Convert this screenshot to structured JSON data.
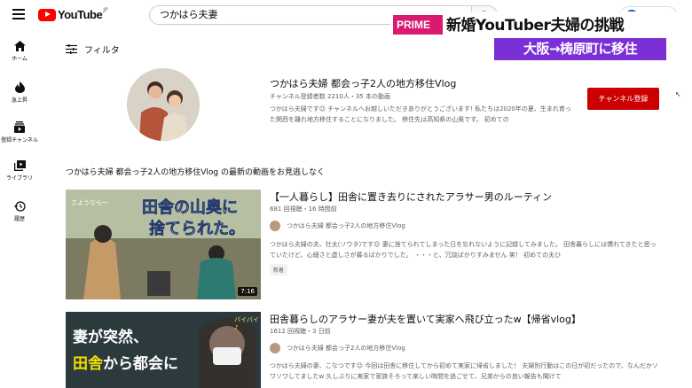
{
  "header": {
    "logo_text": "YouTube",
    "logo_country": "JP",
    "search_value": "つかはら夫妻"
  },
  "sidebar": {
    "items": [
      {
        "label": "ホーム",
        "icon": "home-icon"
      },
      {
        "label": "急上昇",
        "icon": "trending-icon"
      },
      {
        "label": "登録チャンネル",
        "icon": "subscriptions-icon"
      },
      {
        "label": "ライブラリ",
        "icon": "library-icon"
      },
      {
        "label": "履歴",
        "icon": "history-icon"
      }
    ]
  },
  "filter": {
    "label": "フィルタ"
  },
  "channel": {
    "name": "つかはら夫婦 都会っ子2人の地方移住Vlog",
    "stats": "チャンネル登録者数 2210人・35 本の動画",
    "description": "つかはら夫婦です☺ チャンネルへお越しいただきありがとうございます! 私たちは2020年の夏、生まれ育った関西を離れ地方移住することになりました。 移住先は高知県の山奥です。 初めての",
    "subscribe_label": "チャンネル登録"
  },
  "section_title": "つかはら夫婦 都会っ子2人の地方移住Vlog の最新の動画をお見逃しなく",
  "videos": [
    {
      "title": "【一人暮らし】田舎に置き去りにされたアラサー男のルーティン",
      "meta": "681 回視聴・16 時間前",
      "channel": "つかはら夫婦 都会っ子2人の地方移住Vlog",
      "description": "つかはら夫婦の夫、壮太(ソウタ)です☺ 妻に捨てられてしまった日を忘れないように記録してみました。 田舎暮らしには慣れてきたと思っていたけど、心細さと虚しさが募るばかりでした。 ・・・と、冗談ばかりすみません 笑！ 初めての夫ひ",
      "badge": "新着",
      "duration": "7:16",
      "thumb_text_1": "田舎の山奥に",
      "thumb_text_2": "捨てられた。",
      "thumb_small": "さようなら〜"
    },
    {
      "title": "田舎暮らしのアラサー妻が夫を置いて実家へ飛び立ったw【帰省vlog】",
      "meta": "1612 回視聴・3 日前",
      "channel": "つかはら夫婦 都会っ子2人の地方移住Vlog",
      "description": "つかはら夫婦の妻、こなつです☺ 今回は田舎に移住してから初めて実家に帰省しました！ 夫婦別行動はこの日が初だったので、なんだかソワソワしてましたw 久しぶりに実家で家族そろって楽しい時間を過ごせて、兄弟からの良い報告も聞けて",
      "thumb_text_1": "妻が突然、",
      "thumb_text_2": "田舎",
      "thumb_text_3": "から都会に",
      "thumb_small": "バイバイ♪"
    }
  ],
  "overlay": {
    "prime": "PRIME",
    "title": "新婚YouTuber夫婦の挑戦",
    "subtitle": "大阪→梼原町に移住"
  },
  "colors": {
    "youtube_red": "#ff0000",
    "subscribe_red": "#cc0000",
    "prime_pink": "#d91a6e",
    "subtitle_purple": "#7b2fd6"
  }
}
